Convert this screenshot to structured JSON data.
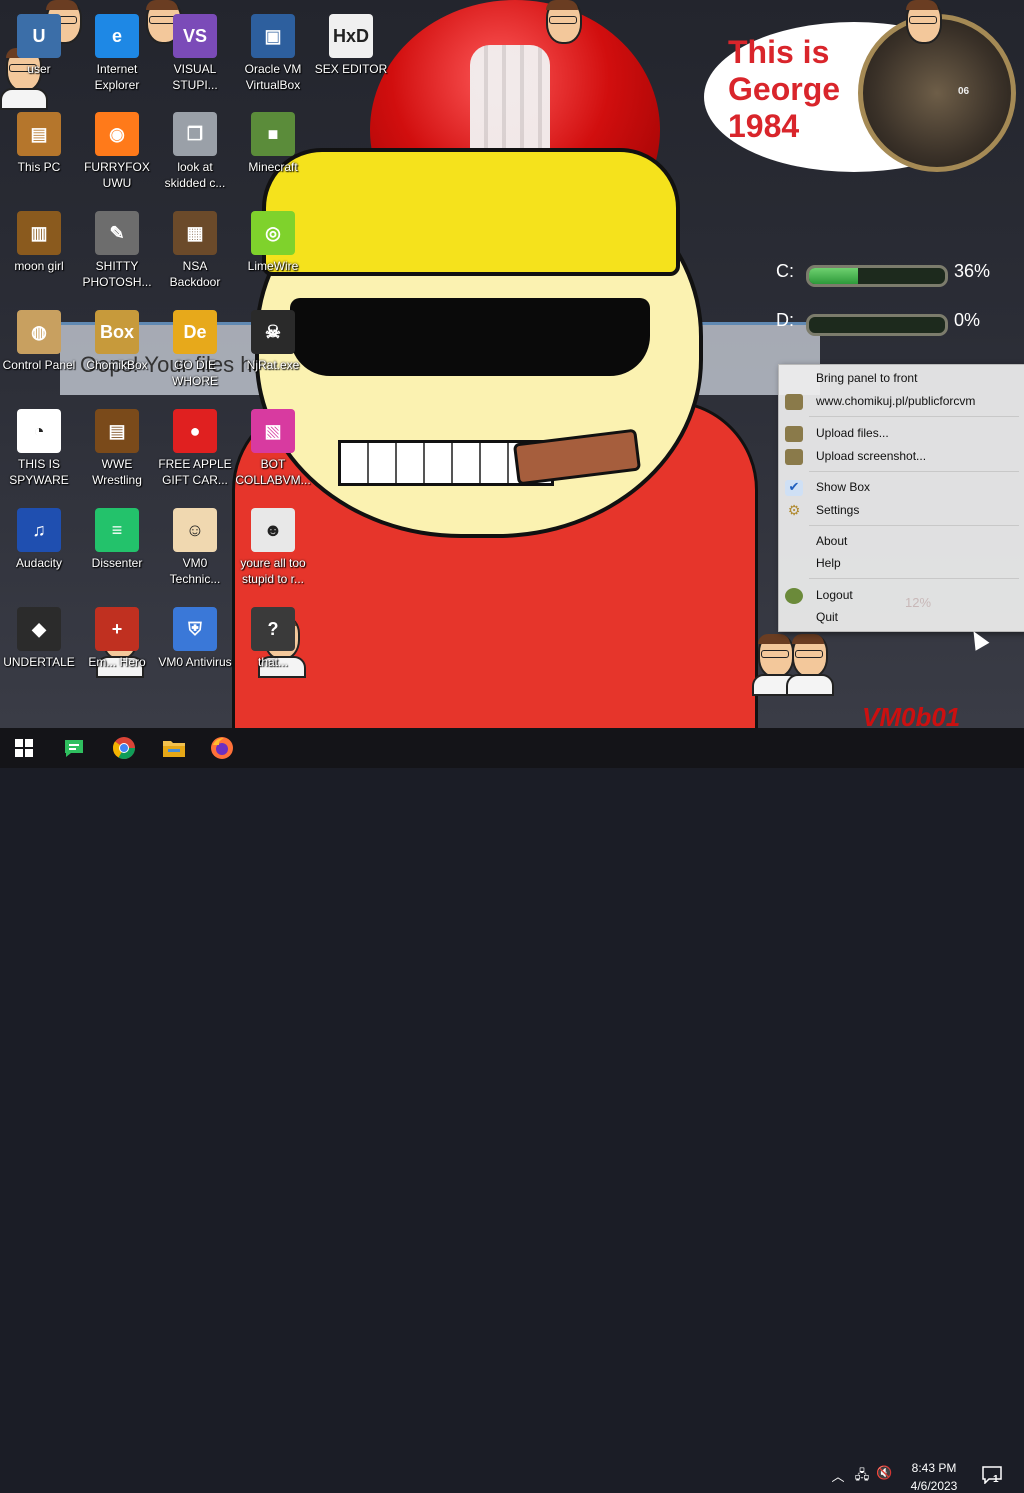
{
  "wallpaper": {
    "speech_bubble": "This is\nGeorge\n1984",
    "banner": "Oops! Your files have been deemed in",
    "tag": "VM0b01",
    "clock_number": "06"
  },
  "widgets": {
    "drives": [
      {
        "label": "C:",
        "percent": "36%",
        "fill": 0.36
      },
      {
        "label": "D:",
        "percent": "0%",
        "fill": 0.0
      }
    ]
  },
  "desktop_icons": [
    {
      "name": "user",
      "label": "user",
      "color": "#3b6ea8",
      "symbol": "U"
    },
    {
      "name": "internet-explorer",
      "label": "Internet Explorer",
      "color": "#1e88e5",
      "symbol": "e"
    },
    {
      "name": "visual-studio",
      "label": "VISUAL STUPI...",
      "color": "#7b4bb8",
      "symbol": "VS"
    },
    {
      "name": "oracle-vm-virtualbox",
      "label": "Oracle VM VirtualBox",
      "color": "#2d5f9e",
      "symbol": "▣"
    },
    {
      "name": "sex-editor",
      "label": "SEX EDITOR",
      "color": "#f0f0f0",
      "symbol": "HxD"
    },
    {
      "name": "this-pc",
      "label": "This PC",
      "color": "#b5762c",
      "symbol": "▤"
    },
    {
      "name": "furryfox",
      "label": "FURRYFOX UWU",
      "color": "#ff7a1a",
      "symbol": "◉"
    },
    {
      "name": "look-at-skidded",
      "label": "look at skidded c...",
      "color": "#9aa0a8",
      "symbol": "❐"
    },
    {
      "name": "minecraft",
      "label": "Minecraft",
      "color": "#5b8c3a",
      "symbol": "■"
    },
    {
      "name": "moon-girl",
      "label": "moon girl",
      "color": "#8a5a1e",
      "symbol": "▥"
    },
    {
      "name": "shitty-photoshop",
      "label": "SHITTY PHOTOSH...",
      "color": "#6d6d6d",
      "symbol": "✎"
    },
    {
      "name": "nsa-backdoor",
      "label": "NSA Backdoor",
      "color": "#6b4a2a",
      "symbol": "▦"
    },
    {
      "name": "limewire",
      "label": "LimeWire",
      "color": "#7fd22c",
      "symbol": "◎"
    },
    {
      "name": "control-panel",
      "label": "Control Panel",
      "color": "#c8a060",
      "symbol": "◍"
    },
    {
      "name": "chomikbox",
      "label": "ChomikBox",
      "color": "#c79a3b",
      "symbol": "Box"
    },
    {
      "name": "go-die-whore",
      "label": "GO DIE WHORE",
      "color": "#e7a91b",
      "symbol": "De"
    },
    {
      "name": "njrat",
      "label": "NjRat.exe",
      "color": "#2a2a2a",
      "symbol": "☠"
    },
    {
      "name": "this-is-spyware",
      "label": "THIS IS SPYWARE",
      "color": "#ffffff",
      "symbol": "◔"
    },
    {
      "name": "wwe-wrestling",
      "label": "WWE Wrestling",
      "color": "#7a4a1a",
      "symbol": "▤"
    },
    {
      "name": "free-apple-gift-card",
      "label": "FREE APPLE GIFT CAR...",
      "color": "#e02020",
      "symbol": "●"
    },
    {
      "name": "bot-collabvm",
      "label": "BOT COLLABVM...",
      "color": "#d83aa0",
      "symbol": "▧"
    },
    {
      "name": "audacity",
      "label": "Audacity",
      "color": "#1f4fb0",
      "symbol": "♫"
    },
    {
      "name": "dissenter",
      "label": "Dissenter",
      "color": "#23c26b",
      "symbol": "≡"
    },
    {
      "name": "vm0-technician",
      "label": "VM0 Technic...",
      "color": "#f0d8b0",
      "symbol": "☺"
    },
    {
      "name": "youre-all-too-stupid",
      "label": "youre all too stupid to r...",
      "color": "#e8e8e8",
      "symbol": "☻"
    },
    {
      "name": "undertale",
      "label": "UNDERTALE",
      "color": "#2b2b2b",
      "symbol": "◆"
    },
    {
      "name": "emergency-hero",
      "label": "Em... Hero",
      "color": "#c03020",
      "symbol": "+"
    },
    {
      "name": "vm0-antivirus",
      "label": "VM0 Antivirus",
      "color": "#3a78d8",
      "symbol": "⛨"
    },
    {
      "name": "that",
      "label": "that...",
      "color": "#3a3a3a",
      "symbol": "?"
    }
  ],
  "context_menu": {
    "items": [
      {
        "name": "bring-panel-to-front",
        "label": "Bring panel to front"
      },
      {
        "name": "chomikuj-url",
        "label": "www.chomikuj.pl/publicforcvm"
      },
      {
        "name": "upload-files",
        "label": "Upload files..."
      },
      {
        "name": "upload-screenshot",
        "label": "Upload screenshot..."
      },
      {
        "name": "show-box",
        "label": "Show Box"
      },
      {
        "name": "settings",
        "label": "Settings"
      },
      {
        "name": "about",
        "label": "About"
      },
      {
        "name": "help",
        "label": "Help"
      },
      {
        "name": "logout",
        "label": "Logout"
      },
      {
        "name": "quit",
        "label": "Quit"
      }
    ],
    "faded_percent": "12%"
  },
  "taskbar": {
    "pinned": [
      "start-icon",
      "dissenter-icon",
      "chrome-icon",
      "file-explorer-icon",
      "firefox-icon"
    ],
    "time": "8:43 PM",
    "date": "4/6/2023",
    "notification_count": "1"
  }
}
